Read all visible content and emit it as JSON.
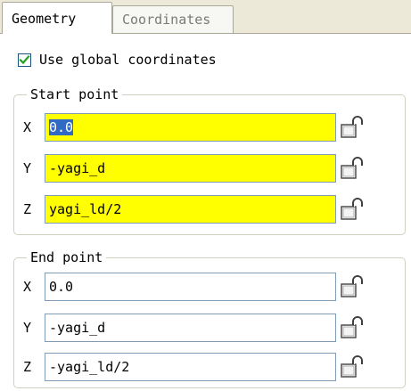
{
  "tabs": [
    {
      "label": "Geometry",
      "active": true
    },
    {
      "label": "Coordinates",
      "active": false
    }
  ],
  "use_global": {
    "label": "Use global coordinates",
    "checked": true
  },
  "start_point": {
    "legend": "Start point",
    "rows": [
      {
        "axis": "X",
        "value": "0.0",
        "highlight": "yellow",
        "selected": true
      },
      {
        "axis": "Y",
        "value": "-yagi_d",
        "highlight": "yellow",
        "selected": false
      },
      {
        "axis": "Z",
        "value": "yagi_ld/2",
        "highlight": "yellow",
        "selected": false
      }
    ]
  },
  "end_point": {
    "legend": "End point",
    "rows": [
      {
        "axis": "X",
        "value": "0.0",
        "highlight": "white",
        "selected": false
      },
      {
        "axis": "Y",
        "value": "-yagi_d",
        "highlight": "white",
        "selected": false
      },
      {
        "axis": "Z",
        "value": "-yagi_ld/2",
        "highlight": "white",
        "selected": false
      }
    ]
  },
  "icons": {
    "checkbox": "checkmark-icon",
    "lock": "unlock-icon"
  },
  "colors": {
    "window_bg": "#ece9d8",
    "panel_bg": "#ffffff",
    "field_highlight": "#ffff00",
    "selection": "#316ac5",
    "check": "#21a121"
  }
}
